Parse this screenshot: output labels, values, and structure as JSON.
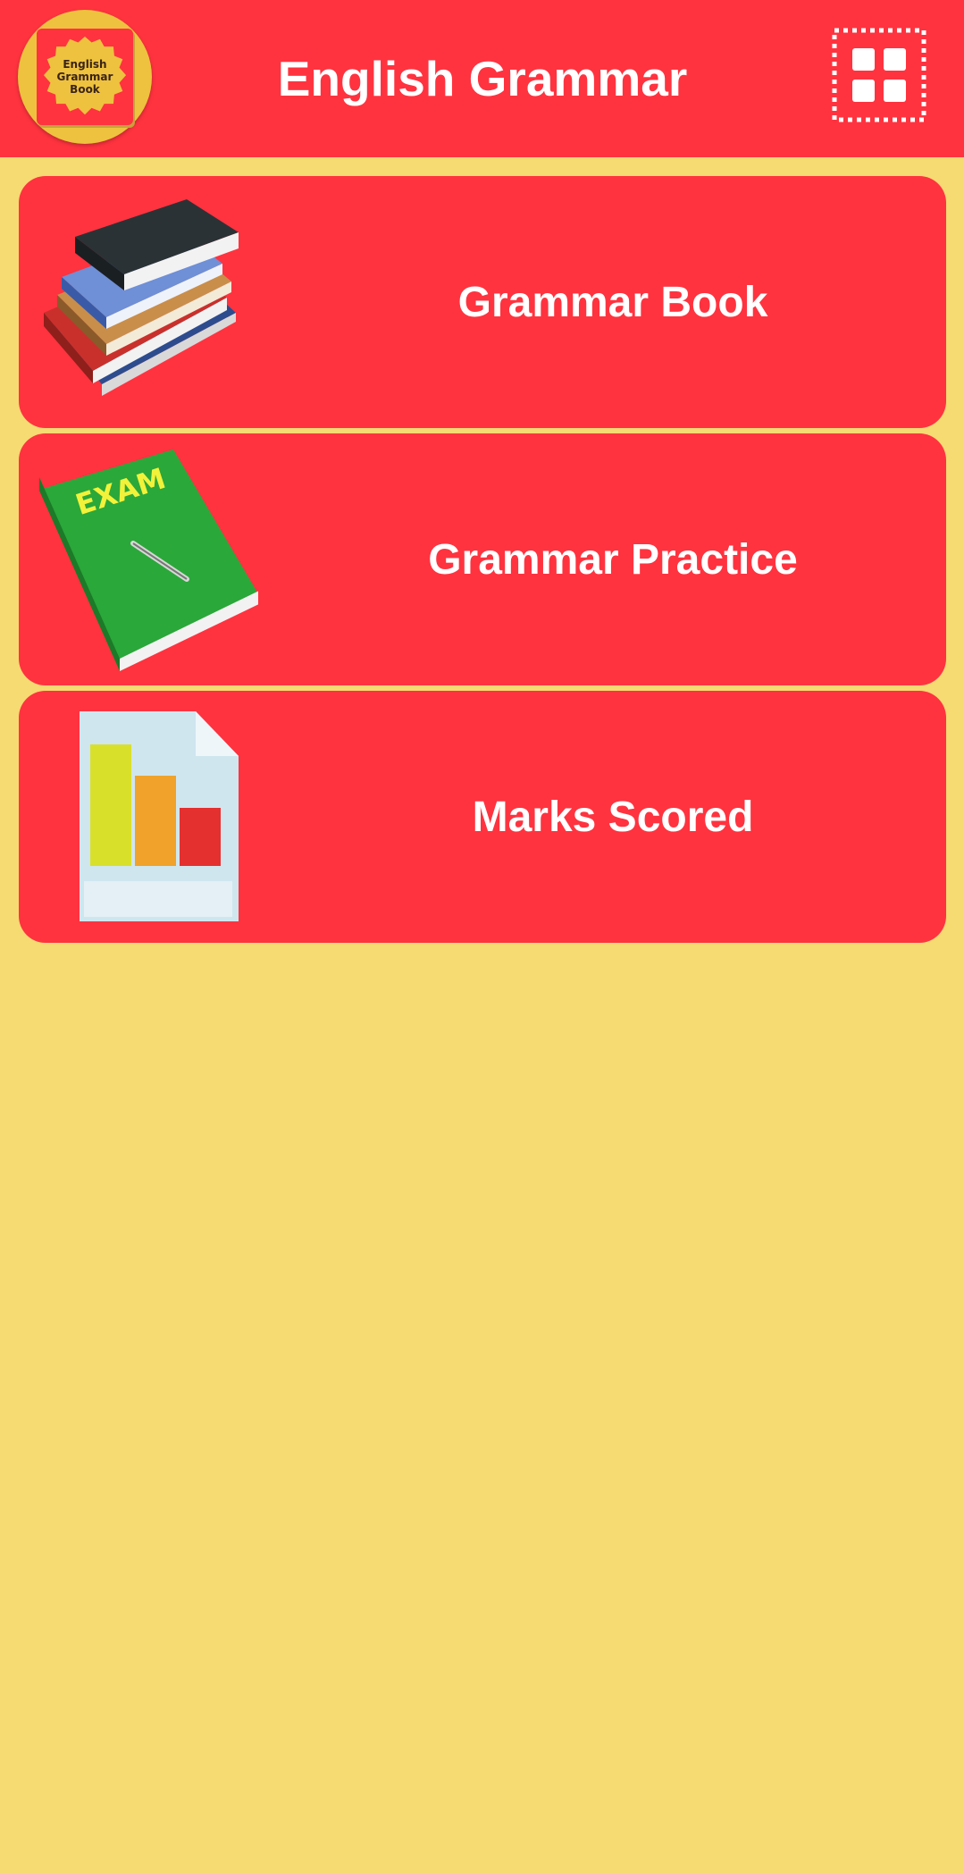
{
  "header": {
    "title": "English Grammar",
    "logo_text": "English\nGrammar\nBook",
    "menu_icon": "grid-menu-icon"
  },
  "menu": {
    "items": [
      {
        "label": "Grammar Book",
        "icon": "books-stack-icon"
      },
      {
        "label": "Grammar Practice",
        "icon": "exam-book-icon",
        "icon_text": "EXAM"
      },
      {
        "label": "Marks Scored",
        "icon": "bar-chart-report-icon"
      }
    ]
  },
  "colors": {
    "background": "#F6DA72",
    "primary": "#FF333F",
    "logo_circle": "#EEC23E",
    "text": "#FFFFFF"
  }
}
